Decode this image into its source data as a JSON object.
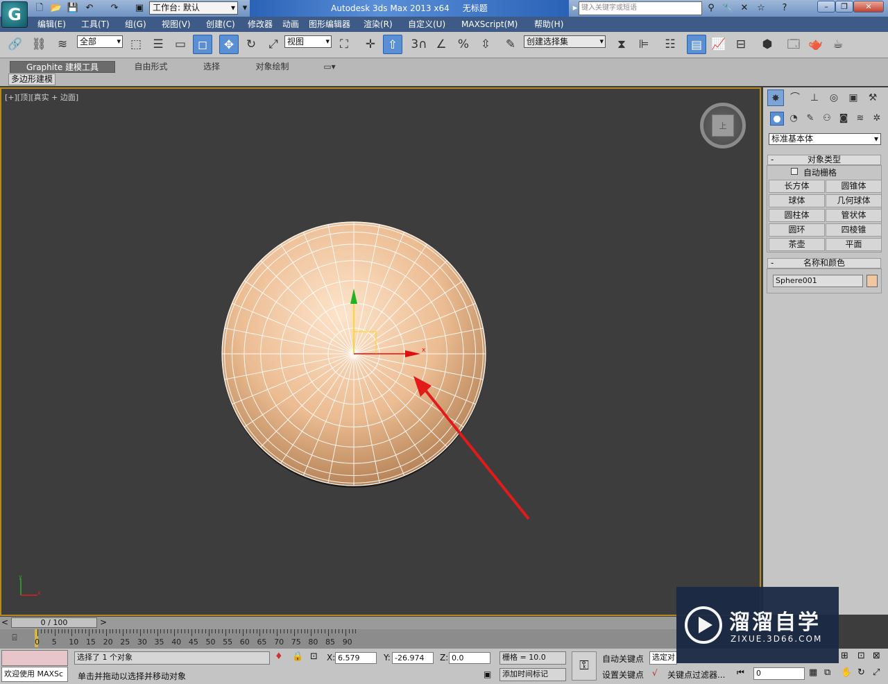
{
  "titlebar": {
    "app_logo": "G",
    "workspace": "工作台: 默认",
    "app_title": "Autodesk 3ds Max  2013 x64",
    "doc_title": "无标题",
    "search_placeholder": "键入关键字或短语"
  },
  "menu": [
    "编辑(E)",
    "工具(T)",
    "组(G)",
    "视图(V)",
    "创建(C)",
    "修改器",
    "动画",
    "图形编辑器",
    "渲染(R)",
    "自定义(U)",
    "MAXScript(M)",
    "帮助(H)"
  ],
  "toolbar": {
    "filter": "全部",
    "refcoord": "视图",
    "named_sel": "创建选择集",
    "snap3": "3",
    "pct": "%"
  },
  "ribbon": {
    "tabs": [
      "Graphite 建模工具",
      "自由形式",
      "选择",
      "对象绘制"
    ],
    "sub": "多边形建模"
  },
  "viewport": {
    "label": "[+][顶][真实 + 边面]",
    "navcube_face": "上",
    "axis_x": "x",
    "axis_y": "y"
  },
  "panel": {
    "category": "标准基本体",
    "object_type": "对象类型",
    "autogrid": "自动栅格",
    "buttons": [
      "长方体",
      "圆锥体",
      "球体",
      "几何球体",
      "圆柱体",
      "管状体",
      "圆环",
      "四棱锥",
      "茶壶",
      "平面"
    ],
    "name_color": "名称和颜色",
    "object_name": "Sphere001",
    "object_color": "#f1c6a0"
  },
  "timeline": {
    "slider": "0 / 100",
    "ticks": [
      "0",
      "5",
      "10",
      "15",
      "20",
      "25",
      "30",
      "35",
      "40",
      "45",
      "50",
      "55",
      "60",
      "65",
      "70",
      "75",
      "80",
      "85",
      "90"
    ]
  },
  "status": {
    "maxscript": "欢迎使用 MAXSc",
    "selected": "选择了 1 个对象",
    "prompt": "单击并拖动以选择并移动对象",
    "x_label": "X:",
    "x": "6.579",
    "y_label": "Y:",
    "y": "-26.974",
    "z_label": "Z:",
    "z": "0.0",
    "grid": "栅格 = 10.0",
    "add_tag": "添加时间标记",
    "autokey": "自动关键点",
    "setkey": "设置关键点",
    "selected_set": "选定对",
    "key_filter": "关键点过滤器...",
    "frame": "0"
  },
  "watermark": {
    "brand": "溜溜自学",
    "url": "ZIXUE.3D66.COM"
  }
}
